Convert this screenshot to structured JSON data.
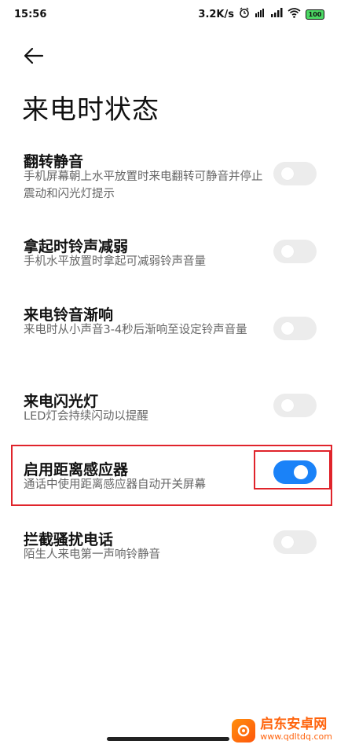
{
  "status_bar": {
    "time": "15:56",
    "speed": "3.2K/s",
    "battery": "100"
  },
  "page": {
    "title": "来电时状态"
  },
  "settings": [
    {
      "title": "翻转静音",
      "desc": "手机屏幕朝上水平放置时来电翻转可静音并停止震动和闪光灯提示",
      "on": false
    },
    {
      "title": "拿起时铃声减弱",
      "desc": "手机水平放置时拿起可减弱铃声音量",
      "on": false
    },
    {
      "title": "来电铃音渐响",
      "desc": "来电时从小声音3-4秒后渐响至设定铃声音量",
      "on": false
    },
    {
      "title": "来电闪光灯",
      "desc": "LED灯会持续闪动以提醒",
      "on": false
    },
    {
      "title": "启用距离感应器",
      "desc": "通话中使用距离感应器自动开关屏幕",
      "on": true
    },
    {
      "title": "拦截骚扰电话",
      "desc": "陌生人来电第一声响铃静音",
      "on": false
    }
  ],
  "colors": {
    "accent": "#1a82f8",
    "toggle_off": "#ececec",
    "annotation": "#e0242b",
    "watermark": "#ff5b00"
  },
  "watermark": {
    "name": "启东安卓网",
    "url": "www.qdltdq.com"
  }
}
